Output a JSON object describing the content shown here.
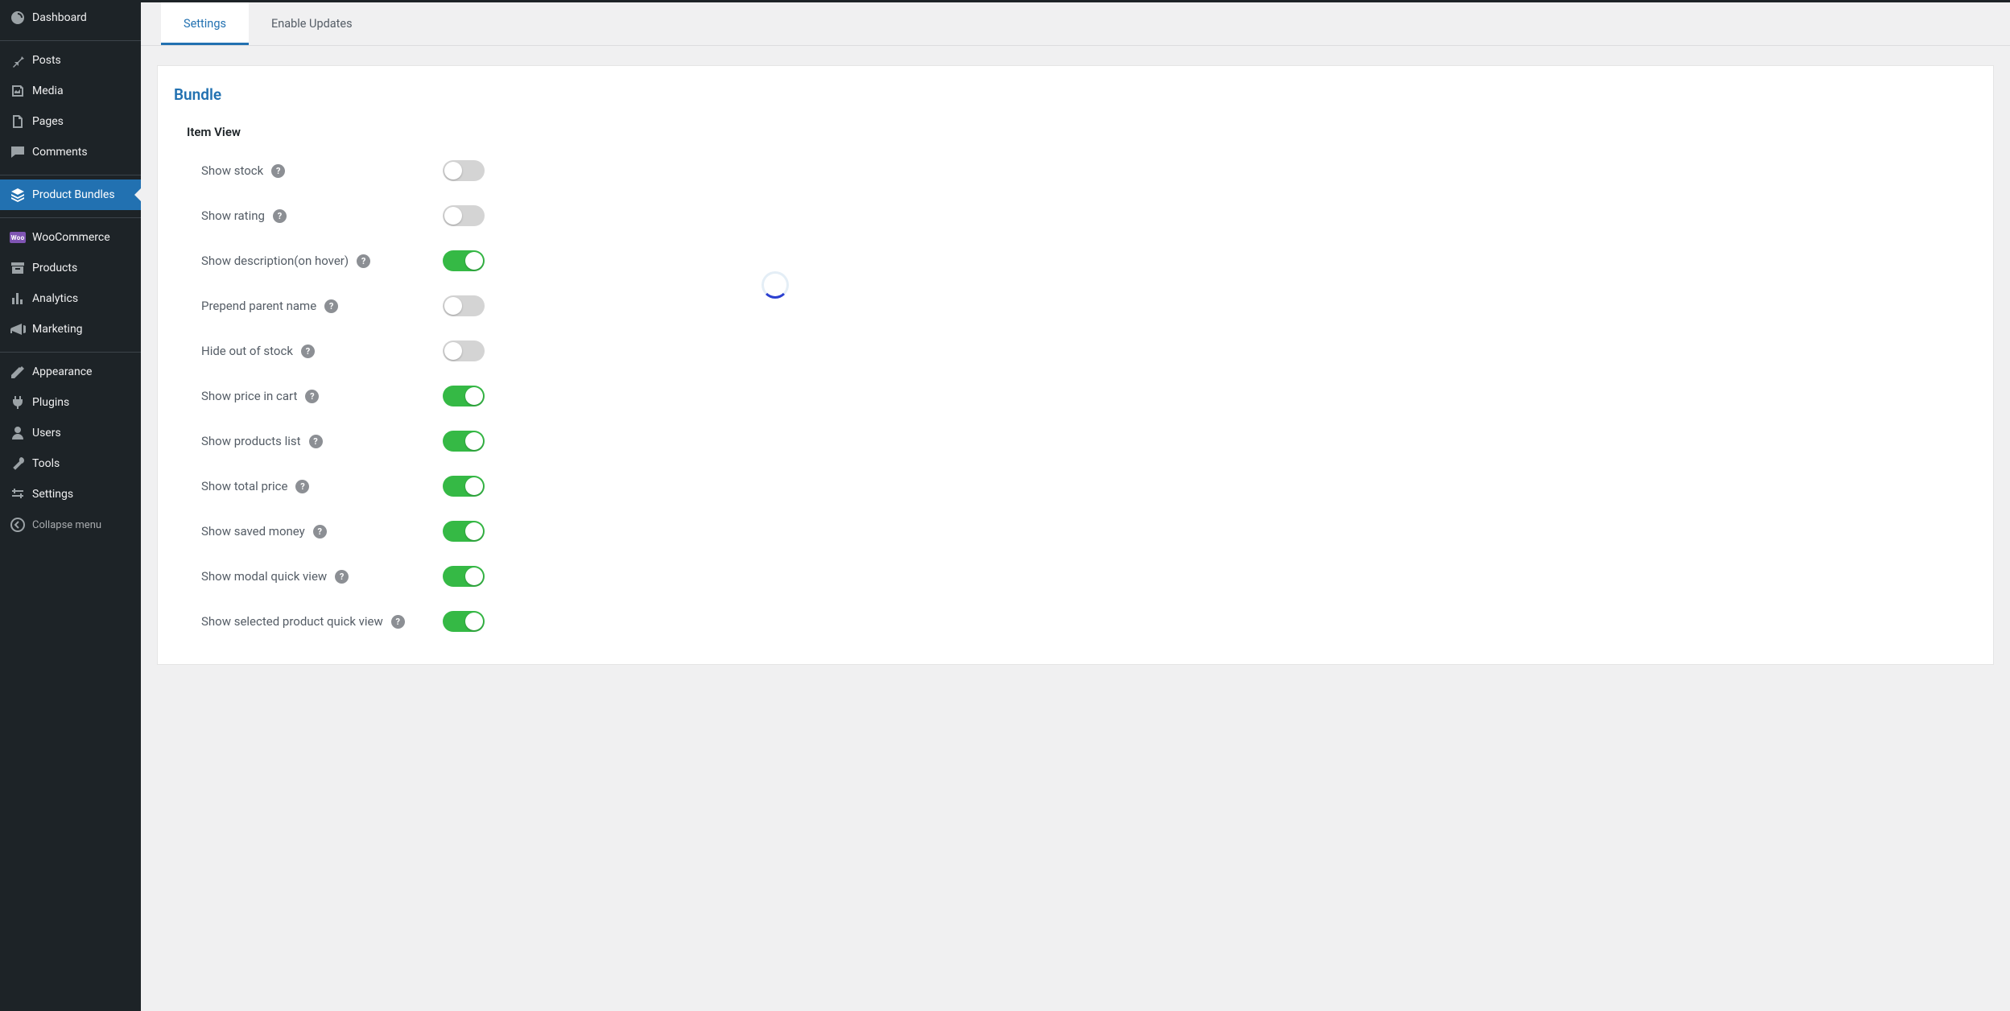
{
  "sidebar": {
    "items": [
      {
        "icon": "dashboard-icon",
        "label": "Dashboard"
      },
      {
        "icon": "pin-icon",
        "label": "Posts"
      },
      {
        "icon": "media-icon",
        "label": "Media"
      },
      {
        "icon": "page-icon",
        "label": "Pages"
      },
      {
        "icon": "comment-icon",
        "label": "Comments"
      },
      {
        "icon": "layers-icon",
        "label": "Product Bundles",
        "active": true
      },
      {
        "icon": "woo-icon",
        "label": "WooCommerce"
      },
      {
        "icon": "archive-icon",
        "label": "Products"
      },
      {
        "icon": "analytics-icon",
        "label": "Analytics"
      },
      {
        "icon": "marketing-icon",
        "label": "Marketing"
      },
      {
        "icon": "appearance-icon",
        "label": "Appearance"
      },
      {
        "icon": "plugins-icon",
        "label": "Plugins"
      },
      {
        "icon": "users-icon",
        "label": "Users"
      },
      {
        "icon": "tools-icon",
        "label": "Tools"
      },
      {
        "icon": "settings-icon",
        "label": "Settings"
      }
    ],
    "collapse_label": "Collapse menu"
  },
  "tabs": {
    "settings": "Settings",
    "enable_updates": "Enable Updates"
  },
  "panel": {
    "title": "Bundle",
    "section_title": "Item View",
    "settings": [
      {
        "label": "Show stock",
        "on": false
      },
      {
        "label": "Show rating",
        "on": false
      },
      {
        "label": "Show description(on hover)",
        "on": true
      },
      {
        "label": "Prepend parent name",
        "on": false
      },
      {
        "label": "Hide out of stock",
        "on": false
      },
      {
        "label": "Show price in cart",
        "on": true
      },
      {
        "label": "Show products list",
        "on": true
      },
      {
        "label": "Show total price",
        "on": true
      },
      {
        "label": "Show saved money",
        "on": true
      },
      {
        "label": "Show modal quick view",
        "on": true
      },
      {
        "label": "Show selected product quick view",
        "on": true
      }
    ]
  },
  "colors": {
    "accent": "#2271b1",
    "toggle_on": "#35b945",
    "toggle_off": "#d4d4d4",
    "sidebar_bg": "#1d2327"
  }
}
